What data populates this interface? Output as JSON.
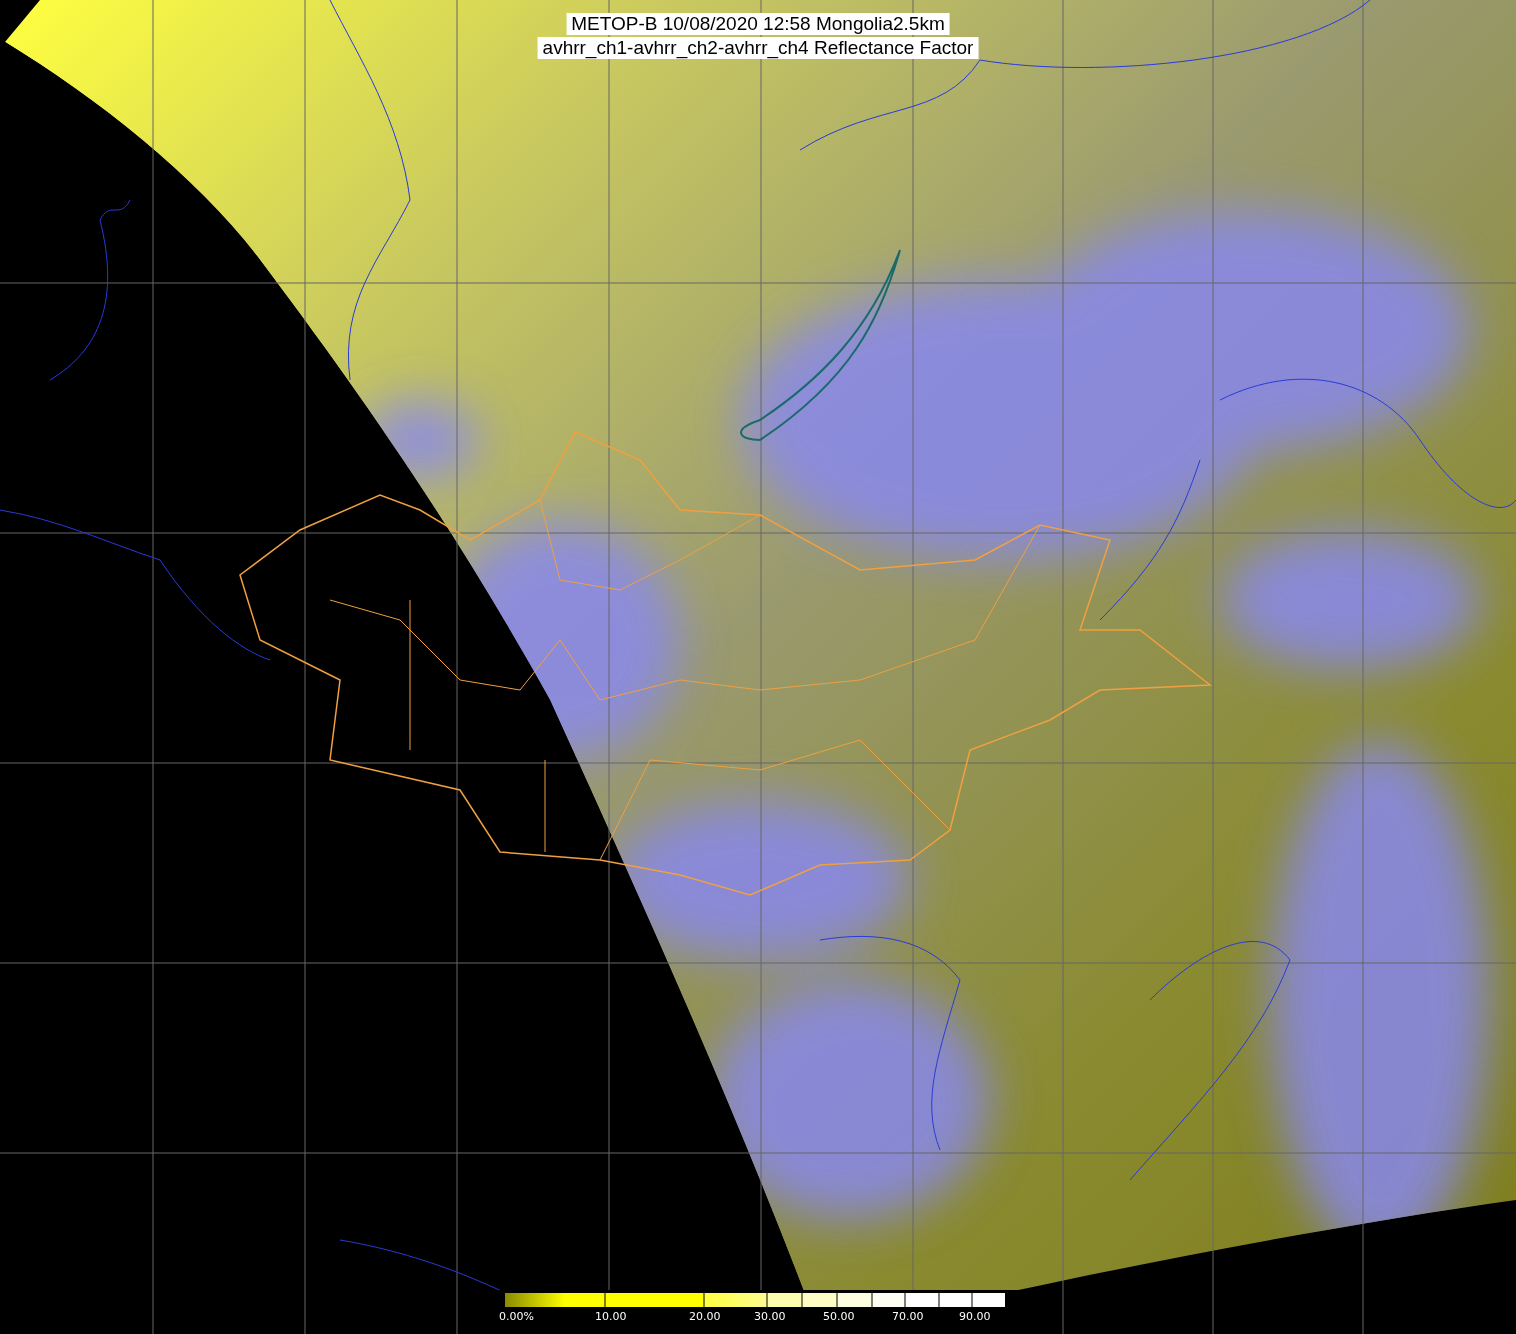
{
  "title": {
    "lines": [
      "METOP-B 10/08/2020 12:58 Mongolia2.5km",
      "avhrr_ch1-avhrr_ch2-avhrr_ch4 Reflectance Factor"
    ]
  },
  "colorbar": {
    "labels": [
      "0.00%",
      "10.00",
      "20.00",
      "30.00",
      "50.00",
      "70.00",
      "90.00"
    ]
  }
}
